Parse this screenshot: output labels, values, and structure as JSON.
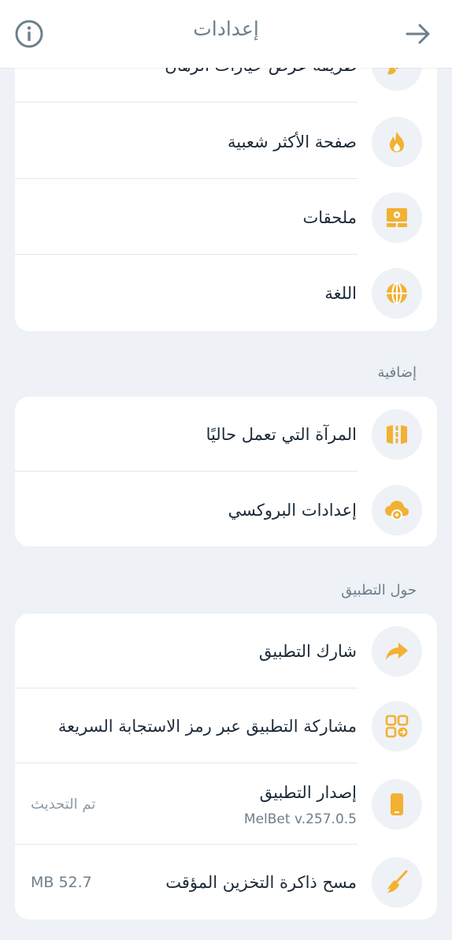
{
  "header": {
    "title": "إعدادات",
    "info_icon": "info-icon",
    "back_icon": "arrow-right-icon"
  },
  "colors": {
    "accent": "#f2b132",
    "icon_bg": "#eef1f6",
    "background": "#eef1f6",
    "card": "#ffffff",
    "muted_text": "#6d7f8c"
  },
  "group1": {
    "items": [
      {
        "label": "طريقة عرض خيارات الرهان",
        "icon": "brush-icon"
      },
      {
        "label": "صفحة الأكثر شعبية",
        "icon": "fire-icon"
      },
      {
        "label": "ملحقات",
        "icon": "widget-settings-icon"
      },
      {
        "label": "اللغة",
        "icon": "globe-icon"
      }
    ]
  },
  "section_extra": {
    "title": "إضافية"
  },
  "group2": {
    "items": [
      {
        "label": "المرآة التي تعمل حاليًا",
        "icon": "mirror-road-icon"
      },
      {
        "label": "إعدادات البروكسي",
        "icon": "cloud-settings-icon"
      }
    ]
  },
  "section_about": {
    "title": "حول التطبيق"
  },
  "group3": {
    "items": [
      {
        "label": "شارك التطبيق",
        "icon": "share-arrow-icon"
      },
      {
        "label": "مشاركة التطبيق عبر رمز الاستجابة السريعة",
        "icon": "qr-code-icon"
      },
      {
        "label": "إصدار التطبيق",
        "sub": "MelBet v.257.0.5",
        "value": "تم التحديث",
        "icon": "phone-icon"
      },
      {
        "label": "مسح ذاكرة التخزين المؤقت",
        "value": "MB 52.7",
        "icon": "broom-icon"
      }
    ]
  }
}
